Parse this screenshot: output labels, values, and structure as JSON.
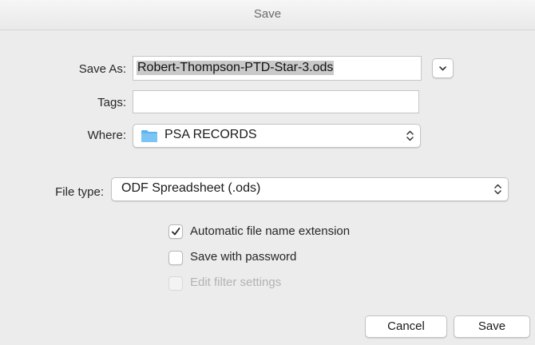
{
  "dialog": {
    "title": "Save"
  },
  "save_as": {
    "label": "Save As:",
    "value": "Robert-Thompson-PTD-Star-3.ods"
  },
  "tags": {
    "label": "Tags:",
    "value": ""
  },
  "where": {
    "label": "Where:",
    "value": "PSA RECORDS",
    "icon": "folder-icon"
  },
  "file_type": {
    "label": "File type:",
    "value": "ODF Spreadsheet (.ods)"
  },
  "options": {
    "auto_extension": {
      "label": "Automatic file name extension",
      "checked": true
    },
    "save_password": {
      "label": "Save with password",
      "checked": false
    },
    "edit_filter": {
      "label": "Edit filter settings",
      "checked": false,
      "disabled": true
    }
  },
  "buttons": {
    "cancel": "Cancel",
    "save": "Save"
  },
  "colors": {
    "folder": "#5fb3ee",
    "background": "#ececec"
  }
}
